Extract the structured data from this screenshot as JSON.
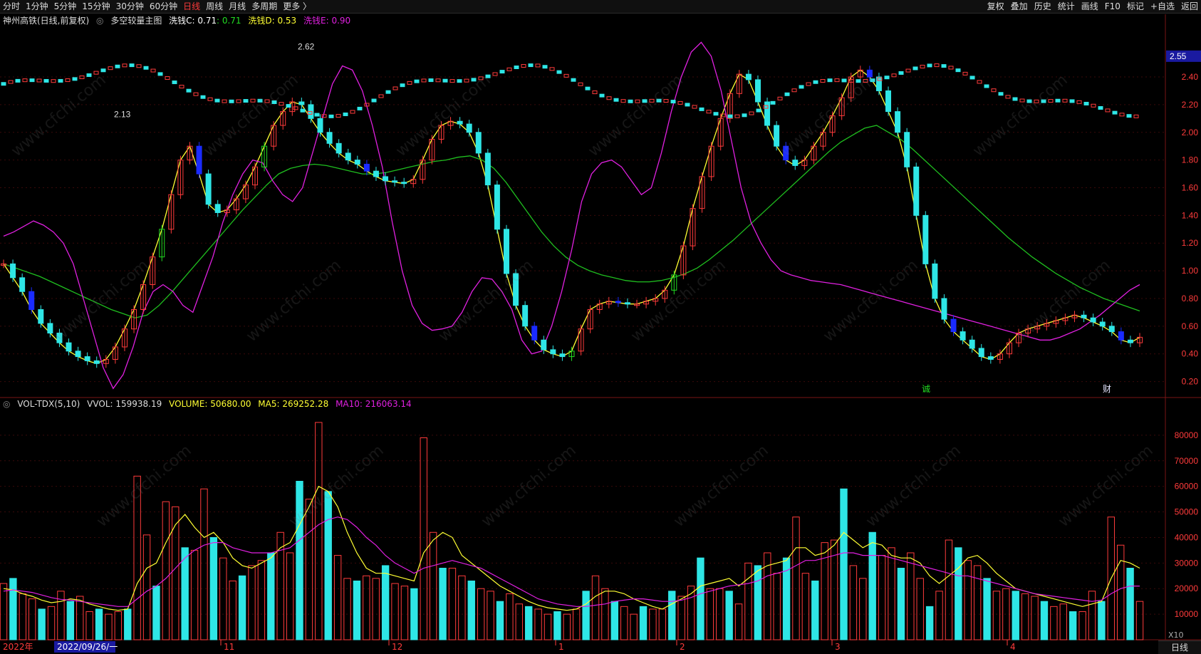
{
  "toolbar": {
    "periods": [
      "分时",
      "1分钟",
      "5分钟",
      "15分钟",
      "30分钟",
      "60分钟",
      "日线",
      "周线",
      "月线",
      "多周期",
      "更多 〉"
    ],
    "active": "日线",
    "right_items": [
      "复权",
      "叠加",
      "历史",
      "统计",
      "画线",
      "F10",
      "标记",
      "+自选",
      "返回"
    ]
  },
  "main_legend": {
    "title": "神州高铁(日线,前复权)",
    "indicator": "多空较量主图",
    "c_label": "洗钱C: 0.71",
    "c_extra": ": 0.71",
    "d_label": "洗钱D: 0.53",
    "e_label": "洗钱E: 0.90"
  },
  "vol_legend": {
    "name": "VOL-TDX(5,10)",
    "vvol": "VVOL: 159938.19",
    "volume": "VOLUME: 50680.00",
    "ma5": "MA5: 269252.28",
    "ma10": "MA10: 216063.14"
  },
  "annotations": {
    "high": "2.62",
    "low": "2.13",
    "marker1": "诚",
    "marker2": "财",
    "last_price": "2.55"
  },
  "x_axis": {
    "start": "2022年",
    "cursor": "2022/09/26/一",
    "months": [
      "11",
      "12",
      "1",
      "2",
      "3",
      "4"
    ]
  },
  "status_label": "日线",
  "x10_label": "X10",
  "watermark": "www.cfchi.com",
  "colors": {
    "up": "#ff3b3b",
    "down": "#2ee6e6",
    "strong_down": "#1a2bff",
    "green": "#22dd22",
    "yellow": "#ffff33",
    "magenta": "#e020e0",
    "ma_green": "#1fbf1f"
  },
  "chart_data": [
    {
      "type": "candlestick",
      "title": "神州高铁(日线,前复权)",
      "y_ticks": [
        0.2,
        0.4,
        0.6,
        0.8,
        1.0,
        1.2,
        1.4,
        1.6,
        1.8,
        2.0,
        2.2,
        2.4
      ],
      "ylim": [
        0.1,
        2.75
      ],
      "series": [
        {
          "name": "洗钱C",
          "values": [
            1.05,
            0.95,
            0.85,
            0.72,
            0.62,
            0.55,
            0.48,
            0.42,
            0.38,
            0.35,
            0.33,
            0.36,
            0.45,
            0.58,
            0.72,
            0.9,
            1.1,
            1.3,
            1.55,
            1.8,
            1.9,
            1.7,
            1.48,
            1.42,
            1.44,
            1.52,
            1.62,
            1.75,
            1.9,
            2.05,
            2.15,
            2.22,
            2.2,
            2.1,
            2.0,
            1.92,
            1.85,
            1.8,
            1.77,
            1.72,
            1.68,
            1.65,
            1.64,
            1.63,
            1.66,
            1.8,
            1.95,
            2.05,
            2.08,
            2.06,
            2.0,
            1.85,
            1.62,
            1.3,
            0.98,
            0.75,
            0.6,
            0.5,
            0.43,
            0.4,
            0.38,
            0.42,
            0.58,
            0.72,
            0.76,
            0.78,
            0.77,
            0.76,
            0.76,
            0.78,
            0.8,
            0.86,
            0.97,
            1.18,
            1.45,
            1.68,
            1.9,
            2.1,
            2.28,
            2.42,
            2.38,
            2.22,
            2.05,
            1.9,
            1.8,
            1.76,
            1.8,
            1.9,
            2.0,
            2.12,
            2.25,
            2.4,
            2.45,
            2.4,
            2.3,
            2.15,
            2.0,
            1.75,
            1.4,
            1.05,
            0.8,
            0.65,
            0.56,
            0.5,
            0.44,
            0.38,
            0.36,
            0.4,
            0.48,
            0.55,
            0.58,
            0.6,
            0.62,
            0.64,
            0.66,
            0.68,
            0.66,
            0.63,
            0.6,
            0.56,
            0.5,
            0.48,
            0.52
          ]
        },
        {
          "name": "洗钱D",
          "values": [
            1.05,
            1.02,
            0.99,
            0.96,
            0.92,
            0.88,
            0.84,
            0.8,
            0.76,
            0.72,
            0.69,
            0.66,
            0.68,
            0.75,
            0.84,
            0.94,
            1.04,
            1.14,
            1.24,
            1.34,
            1.44,
            1.53,
            1.62,
            1.7,
            1.74,
            1.76,
            1.77,
            1.76,
            1.74,
            1.72,
            1.7,
            1.7,
            1.71,
            1.73,
            1.75,
            1.77,
            1.79,
            1.8,
            1.82,
            1.83,
            1.8,
            1.74,
            1.64,
            1.52,
            1.4,
            1.28,
            1.18,
            1.1,
            1.04,
            1.0,
            0.97,
            0.95,
            0.93,
            0.92,
            0.92,
            0.93,
            0.95,
            0.98,
            1.02,
            1.08,
            1.15,
            1.22,
            1.3,
            1.38,
            1.46,
            1.54,
            1.62,
            1.7,
            1.78,
            1.86,
            1.93,
            1.98,
            2.03,
            2.05,
            2.0,
            1.95,
            1.88,
            1.8,
            1.72,
            1.64,
            1.56,
            1.48,
            1.4,
            1.32,
            1.24,
            1.17,
            1.1,
            1.04,
            0.98,
            0.93,
            0.88,
            0.84,
            0.8,
            0.77,
            0.74,
            0.71
          ]
        },
        {
          "name": "洗钱E",
          "values": [
            1.25,
            1.28,
            1.32,
            1.36,
            1.33,
            1.28,
            1.2,
            1.05,
            0.8,
            0.55,
            0.3,
            0.15,
            0.25,
            0.45,
            0.7,
            0.85,
            0.9,
            0.85,
            0.75,
            0.7,
            0.9,
            1.1,
            1.35,
            1.55,
            1.7,
            1.8,
            1.78,
            1.65,
            1.55,
            1.5,
            1.6,
            1.85,
            2.1,
            2.35,
            2.48,
            2.45,
            2.3,
            2.05,
            1.75,
            1.35,
            1.0,
            0.75,
            0.62,
            0.57,
            0.58,
            0.6,
            0.7,
            0.85,
            0.95,
            0.94,
            0.85,
            0.72,
            0.5,
            0.4,
            0.42,
            0.6,
            0.85,
            1.15,
            1.5,
            1.7,
            1.78,
            1.8,
            1.75,
            1.65,
            1.55,
            1.6,
            1.85,
            2.15,
            2.4,
            2.58,
            2.65,
            2.55,
            2.3,
            1.95,
            1.6,
            1.35,
            1.2,
            1.08,
            1.0,
            0.97,
            0.95,
            0.93,
            0.92,
            0.91,
            0.9,
            0.88,
            0.86,
            0.84,
            0.82,
            0.8,
            0.78,
            0.76,
            0.74,
            0.72,
            0.7,
            0.68,
            0.66,
            0.64,
            0.62,
            0.6,
            0.58,
            0.56,
            0.54,
            0.52,
            0.5,
            0.5,
            0.52,
            0.55,
            0.58,
            0.63,
            0.68,
            0.74,
            0.8,
            0.86,
            0.9
          ]
        }
      ],
      "candles_summary": "daily OHLC from 2022-09 to 2023-04; range 0.30-2.62"
    },
    {
      "type": "bar",
      "title": "VOL-TDX(5,10)",
      "y_ticks": [
        10000,
        20000,
        30000,
        40000,
        50000,
        60000,
        70000,
        80000
      ],
      "ylim": [
        0,
        90000
      ],
      "values": [
        22000,
        24000,
        18000,
        16000,
        12000,
        13000,
        19000,
        15000,
        17000,
        11000,
        12000,
        10000,
        11000,
        12000,
        64000,
        41000,
        21000,
        54000,
        52000,
        36000,
        35000,
        59000,
        40000,
        32000,
        23000,
        25000,
        29000,
        31000,
        34000,
        42000,
        34000,
        62000,
        55000,
        85000,
        58000,
        33000,
        24000,
        23000,
        25000,
        24000,
        29000,
        22000,
        21000,
        20000,
        79000,
        42000,
        28000,
        28000,
        25000,
        23000,
        20000,
        19000,
        15000,
        18000,
        14000,
        13000,
        12000,
        10000,
        11000,
        10000,
        12000,
        19000,
        25000,
        20000,
        15000,
        13000,
        10000,
        13000,
        12000,
        12000,
        19000,
        17000,
        21000,
        32000,
        20000,
        20000,
        19000,
        14000,
        30000,
        29000,
        34000,
        26000,
        32000,
        48000,
        26000,
        23000,
        38000,
        39000,
        59000,
        29000,
        24000,
        42000,
        33000,
        36000,
        28000,
        34000,
        24000,
        13000,
        19000,
        39000,
        36000,
        31000,
        29000,
        24000,
        19000,
        20000,
        19000,
        18000,
        17000,
        15000,
        13000,
        14000,
        11000,
        11000,
        19000,
        15000,
        48000,
        37000,
        28000,
        15000
      ],
      "ma5": [
        20000,
        19500,
        18000,
        17000,
        15500,
        14500,
        15000,
        16000,
        15500,
        14000,
        13000,
        12000,
        11500,
        12000,
        22000,
        28000,
        30000,
        38000,
        45000,
        49000,
        44000,
        40000,
        42000,
        38000,
        32000,
        29000,
        28000,
        30000,
        32000,
        36000,
        38000,
        45000,
        52000,
        60000,
        58000,
        52000,
        42000,
        34000,
        28000,
        26000,
        26000,
        25000,
        24000,
        23000,
        34000,
        39000,
        42000,
        40000,
        33000,
        30000,
        27000,
        24000,
        21000,
        19000,
        17000,
        15000,
        13500,
        12500,
        12000,
        11500,
        12000,
        14000,
        17000,
        19000,
        19000,
        18000,
        16000,
        14500,
        13000,
        12000,
        14000,
        16000,
        18000,
        21000,
        22000,
        23000,
        24000,
        21000,
        24000,
        27000,
        29000,
        30000,
        31000,
        36000,
        36000,
        33000,
        34000,
        37000,
        42000,
        39000,
        36000,
        38000,
        37000,
        33000,
        32000,
        32000,
        30000,
        25000,
        22000,
        25000,
        28000,
        32000,
        33000,
        30000,
        26000,
        23000,
        20000,
        19000,
        18000,
        17000,
        16000,
        15000,
        14000,
        13000,
        14000,
        15000,
        24000,
        31000,
        30000,
        28000
      ],
      "ma10": [
        19000,
        19500,
        19000,
        18500,
        17500,
        16500,
        15800,
        15500,
        15000,
        14500,
        14000,
        13500,
        13000,
        13000,
        16000,
        19000,
        21000,
        24000,
        28000,
        32000,
        35000,
        37000,
        38000,
        38000,
        36000,
        35000,
        34000,
        34000,
        34000,
        35000,
        36000,
        39000,
        42000,
        45000,
        47000,
        48000,
        47000,
        44000,
        40000,
        37000,
        33000,
        30000,
        28000,
        26000,
        28000,
        29000,
        30000,
        31000,
        30000,
        29000,
        28000,
        26000,
        24000,
        22000,
        20000,
        18000,
        16000,
        15000,
        14000,
        13500,
        13000,
        13000,
        13500,
        14000,
        15000,
        15500,
        16000,
        16000,
        15500,
        15000,
        15000,
        15500,
        16500,
        18000,
        19000,
        20000,
        21000,
        21500,
        22000,
        23000,
        25000,
        26000,
        27000,
        29000,
        31000,
        31000,
        32000,
        33000,
        34000,
        34000,
        33000,
        33000,
        33000,
        32000,
        31000,
        30000,
        29000,
        28000,
        27000,
        26000,
        25000,
        25000,
        24000,
        23000,
        22000,
        21000,
        20000,
        19000,
        18000,
        17500,
        17000,
        16500,
        16000,
        15500,
        15000,
        15500,
        18000,
        20000,
        21000,
        21000
      ]
    }
  ]
}
